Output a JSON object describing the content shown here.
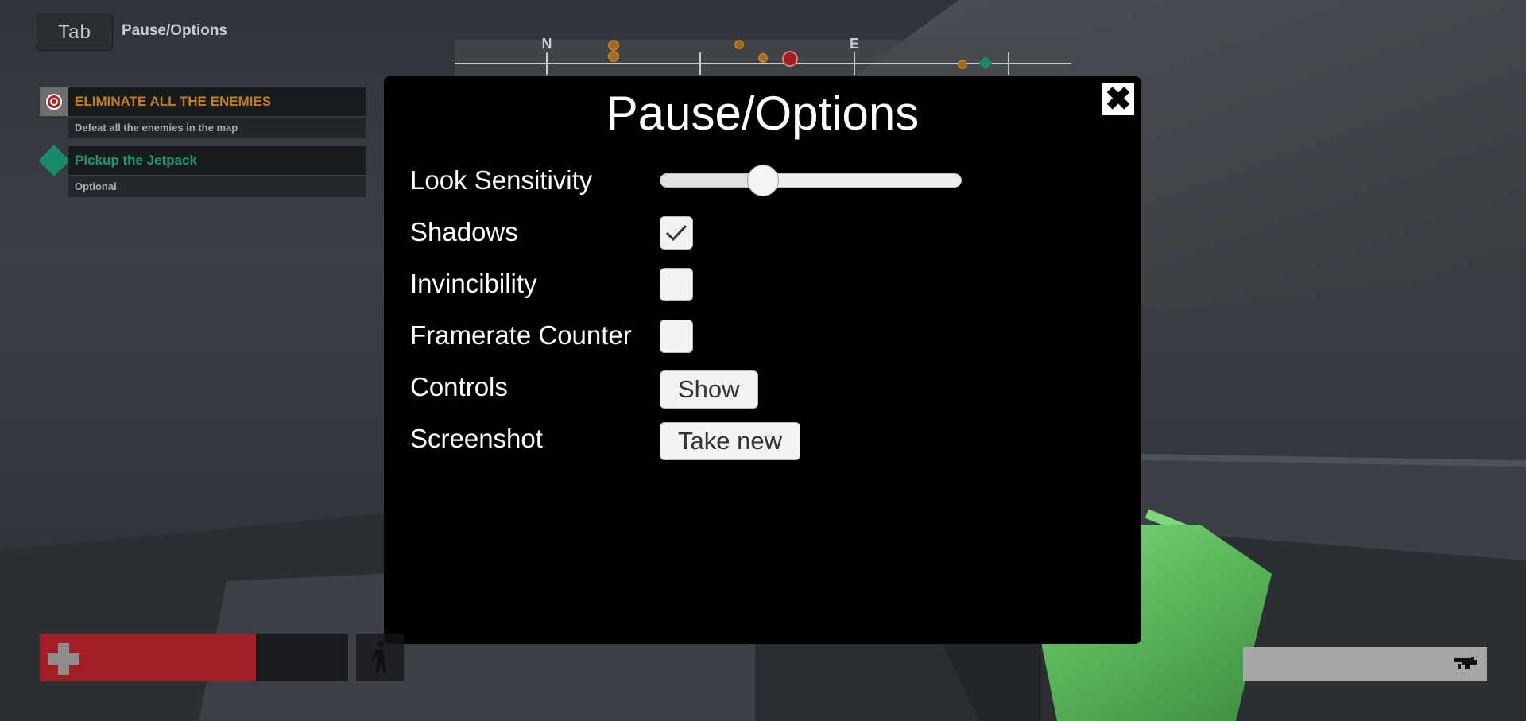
{
  "hud": {
    "tab_key": "Tab",
    "tab_hint": "Pause/Options"
  },
  "objectives": [
    {
      "title": "ELIMINATE ALL THE ENEMIES",
      "description": "Defeat all the enemies in the map",
      "color": "#c47e22",
      "icon": "target-icon"
    },
    {
      "title": "Pickup the Jetpack",
      "description": "Optional",
      "color": "#1a9a72",
      "icon": "diamond-icon"
    }
  ],
  "compass": {
    "north": "N",
    "east": "E"
  },
  "options": {
    "title": "Pause/Options",
    "close_icon": "close-icon",
    "look_sensitivity": {
      "label": "Look Sensitivity",
      "value": 0.34
    },
    "shadows": {
      "label": "Shadows",
      "checked": true
    },
    "invincibility": {
      "label": "Invincibility",
      "checked": false
    },
    "framerate_counter": {
      "label": "Framerate Counter",
      "checked": false
    },
    "controls": {
      "label": "Controls",
      "button": "Show"
    },
    "screenshot": {
      "label": "Screenshot",
      "button": "Take new"
    }
  },
  "health": {
    "value": 0.7,
    "color": "#a31d26",
    "icon": "health-cross-icon"
  },
  "stance": {
    "icon": "walking-person-icon"
  },
  "weapon": {
    "ammo_fraction": 1.0,
    "icon": "blaster-icon"
  }
}
